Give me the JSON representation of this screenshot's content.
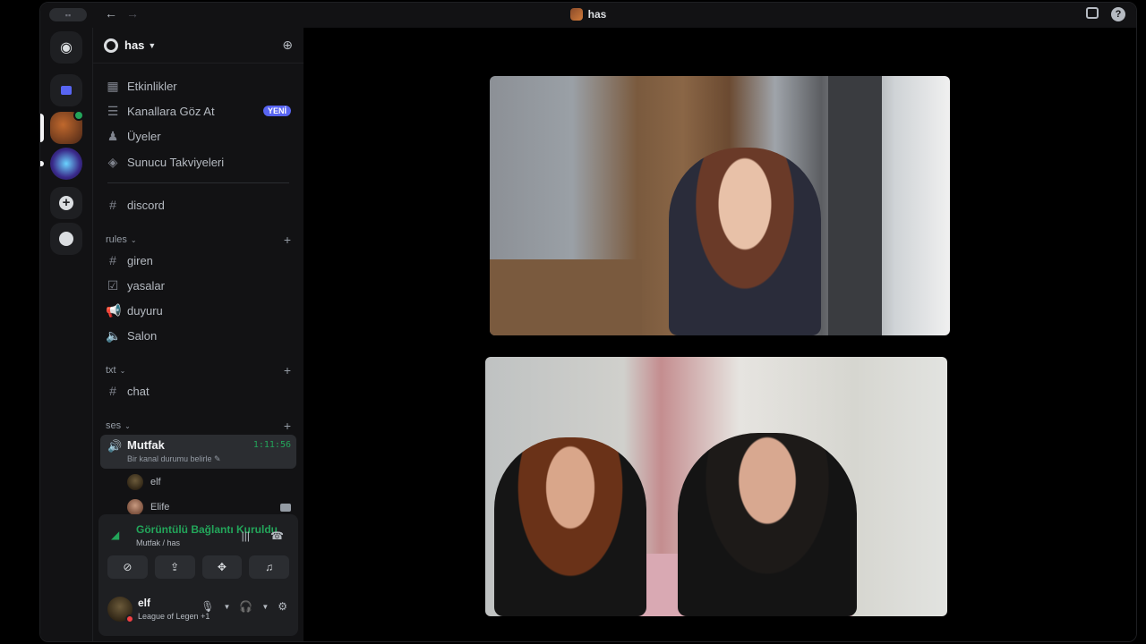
{
  "titlebar": {
    "title": "has",
    "back_icon": "←",
    "forward_icon": "→"
  },
  "server": {
    "name": "has",
    "menu": [
      {
        "label": "Etkinlikler",
        "icon": "calendar-icon"
      },
      {
        "label": "Kanallara Göz At",
        "icon": "browse-channels-icon",
        "badge": "YENİ"
      },
      {
        "label": "Üyeler",
        "icon": "members-icon"
      },
      {
        "label": "Sunucu Takviyeleri",
        "icon": "boost-icon"
      }
    ],
    "top_channel": "discord",
    "categories": [
      {
        "name": "rules",
        "channels": [
          "giren",
          "yasalar",
          "duyuru",
          "Salon"
        ]
      },
      {
        "name": "txt",
        "channels": [
          "chat"
        ]
      },
      {
        "name": "ses",
        "channels": []
      }
    ],
    "active_voice": {
      "name": "Mutfak",
      "timer": "1:11:56",
      "status_prompt": "Bir kanal durumu belirle",
      "users": [
        {
          "name": "elf"
        },
        {
          "name": "Elife"
        }
      ]
    }
  },
  "connection": {
    "status": "Görüntülü Bağlantı Kuruldu",
    "location": "Mutfak / has"
  },
  "user": {
    "name": "elf",
    "activity": "League of Legen +1"
  },
  "colors": {
    "accent": "#5865f2",
    "online": "#23a55a",
    "dnd": "#f23f43",
    "background": "#121214"
  }
}
